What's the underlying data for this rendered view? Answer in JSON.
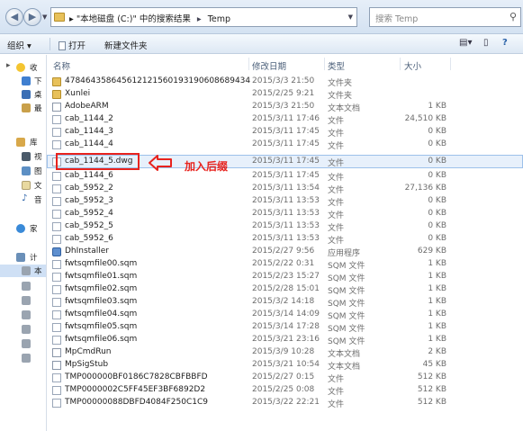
{
  "address_bar": {
    "path": [
      "\"本地磁盘 (C:)\" 中的搜索结果",
      "Temp"
    ],
    "search_placeholder": "搜索 Temp"
  },
  "toolbar": {
    "organize": "组织 ▾",
    "open": "打开",
    "new_folder": "新建文件夹"
  },
  "nav": {
    "items": [
      "收",
      "下",
      "桌",
      "最",
      "库",
      "视",
      "图",
      "文",
      "音",
      "家",
      "计",
      "本",
      "",
      "",
      "",
      "",
      "",
      ""
    ]
  },
  "columns": {
    "name": "名称",
    "date": "修改日期",
    "type": "类型",
    "size": "大小"
  },
  "files": [
    {
      "name": "478464358645612121560193190608689434",
      "date": "2015/3/3 21:50",
      "type": "文件夹",
      "size": "",
      "icon": "folder-icon"
    },
    {
      "name": "Xunlei",
      "date": "2015/2/25 9:21",
      "type": "文件夹",
      "size": "",
      "icon": "folder-icon"
    },
    {
      "name": "AdobeARM",
      "date": "2015/3/3 21:50",
      "type": "文本文档",
      "size": "1 KB",
      "icon": "text-file-icon"
    },
    {
      "name": "cab_1144_2",
      "date": "2015/3/11 17:46",
      "type": "文件",
      "size": "24,510 KB",
      "icon": "file-icon"
    },
    {
      "name": "cab_1144_3",
      "date": "2015/3/11 17:45",
      "type": "文件",
      "size": "0 KB",
      "icon": "file-icon"
    },
    {
      "name": "cab_1144_4",
      "date": "2015/3/11 17:45",
      "type": "文件",
      "size": "0 KB",
      "icon": "file-icon"
    },
    {
      "name": "cab_1144_5.dwg",
      "date": "2015/3/11 17:45",
      "type": "文件",
      "size": "0 KB",
      "icon": "file-icon"
    },
    {
      "name": "cab_1144_6",
      "date": "2015/3/11 17:45",
      "type": "文件",
      "size": "0 KB",
      "icon": "file-icon"
    },
    {
      "name": "cab_5952_2",
      "date": "2015/3/11 13:54",
      "type": "文件",
      "size": "27,136 KB",
      "icon": "file-icon"
    },
    {
      "name": "cab_5952_3",
      "date": "2015/3/11 13:53",
      "type": "文件",
      "size": "0 KB",
      "icon": "file-icon"
    },
    {
      "name": "cab_5952_4",
      "date": "2015/3/11 13:53",
      "type": "文件",
      "size": "0 KB",
      "icon": "file-icon"
    },
    {
      "name": "cab_5952_5",
      "date": "2015/3/11 13:53",
      "type": "文件",
      "size": "0 KB",
      "icon": "file-icon"
    },
    {
      "name": "cab_5952_6",
      "date": "2015/3/11 13:53",
      "type": "文件",
      "size": "0 KB",
      "icon": "file-icon"
    },
    {
      "name": "DhInstaller",
      "date": "2015/2/27 9:56",
      "type": "应用程序",
      "size": "629 KB",
      "icon": "app-icon"
    },
    {
      "name": "fwtsqmfile00.sqm",
      "date": "2015/2/22 0:31",
      "type": "SQM 文件",
      "size": "1 KB",
      "icon": "file-icon"
    },
    {
      "name": "fwtsqmfile01.sqm",
      "date": "2015/2/23 15:27",
      "type": "SQM 文件",
      "size": "1 KB",
      "icon": "file-icon"
    },
    {
      "name": "fwtsqmfile02.sqm",
      "date": "2015/2/28 15:01",
      "type": "SQM 文件",
      "size": "1 KB",
      "icon": "file-icon"
    },
    {
      "name": "fwtsqmfile03.sqm",
      "date": "2015/3/2 14:18",
      "type": "SQM 文件",
      "size": "1 KB",
      "icon": "file-icon"
    },
    {
      "name": "fwtsqmfile04.sqm",
      "date": "2015/3/14 14:09",
      "type": "SQM 文件",
      "size": "1 KB",
      "icon": "file-icon"
    },
    {
      "name": "fwtsqmfile05.sqm",
      "date": "2015/3/14 17:28",
      "type": "SQM 文件",
      "size": "1 KB",
      "icon": "file-icon"
    },
    {
      "name": "fwtsqmfile06.sqm",
      "date": "2015/3/21 23:16",
      "type": "SQM 文件",
      "size": "1 KB",
      "icon": "file-icon"
    },
    {
      "name": "MpCmdRun",
      "date": "2015/3/9 10:28",
      "type": "文本文档",
      "size": "2 KB",
      "icon": "text-file-icon"
    },
    {
      "name": "MpSigStub",
      "date": "2015/3/21 10:54",
      "type": "文本文档",
      "size": "45 KB",
      "icon": "text-file-icon"
    },
    {
      "name": "TMP000000BF0186C7828CBFBBFD",
      "date": "2015/2/27 0:15",
      "type": "文件",
      "size": "512 KB",
      "icon": "file-icon"
    },
    {
      "name": "TMP0000002C5FF45EF3BF6892D2",
      "date": "2015/2/25 0:08",
      "type": "文件",
      "size": "512 KB",
      "icon": "file-icon"
    },
    {
      "name": "TMP00000088DBFD4084F250C1C9",
      "date": "2015/3/22 22:21",
      "type": "文件",
      "size": "512 KB",
      "icon": "file-icon"
    }
  ],
  "annotation": {
    "label": "加入后缀",
    "color": "#e8231e"
  }
}
